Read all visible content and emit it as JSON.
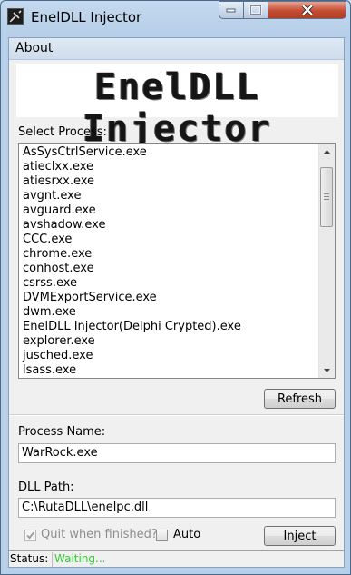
{
  "window": {
    "title": "EnelDLL Injector"
  },
  "menu": {
    "about": "About"
  },
  "logo": {
    "text": "EnelDLL Injector"
  },
  "process_list": {
    "label": "Select Process:",
    "items": [
      "AsSysCtrlService.exe",
      "atieclxx.exe",
      "atiesrxx.exe",
      "avgnt.exe",
      "avguard.exe",
      "avshadow.exe",
      "CCC.exe",
      "chrome.exe",
      "conhost.exe",
      "csrss.exe",
      "DVMExportService.exe",
      "dwm.exe",
      "EnelDLL Injector(Delphi Crypted).exe",
      "explorer.exe",
      "jusched.exe",
      "lsass.exe"
    ]
  },
  "buttons": {
    "refresh": "Refresh",
    "inject": "Inject"
  },
  "process_name": {
    "label": "Process Name:",
    "value": "WarRock.exe"
  },
  "dll_path": {
    "label": "DLL Path:",
    "value": "C:\\RutaDLL\\enelpc.dll"
  },
  "options": {
    "quit_label": "Quit when finished?",
    "quit_checked": true,
    "quit_enabled": false,
    "auto_label": "Auto",
    "auto_checked": false
  },
  "status": {
    "label": "Status:",
    "value": "Waiting...",
    "value_color": "#33cc33"
  },
  "icons": {
    "app": "syringe-icon",
    "minimize": "minimize-icon",
    "maximize": "maximize-icon",
    "close": "close-icon",
    "scroll_up": "chevron-up-icon",
    "scroll_down": "chevron-down-icon",
    "check": "check-icon"
  }
}
